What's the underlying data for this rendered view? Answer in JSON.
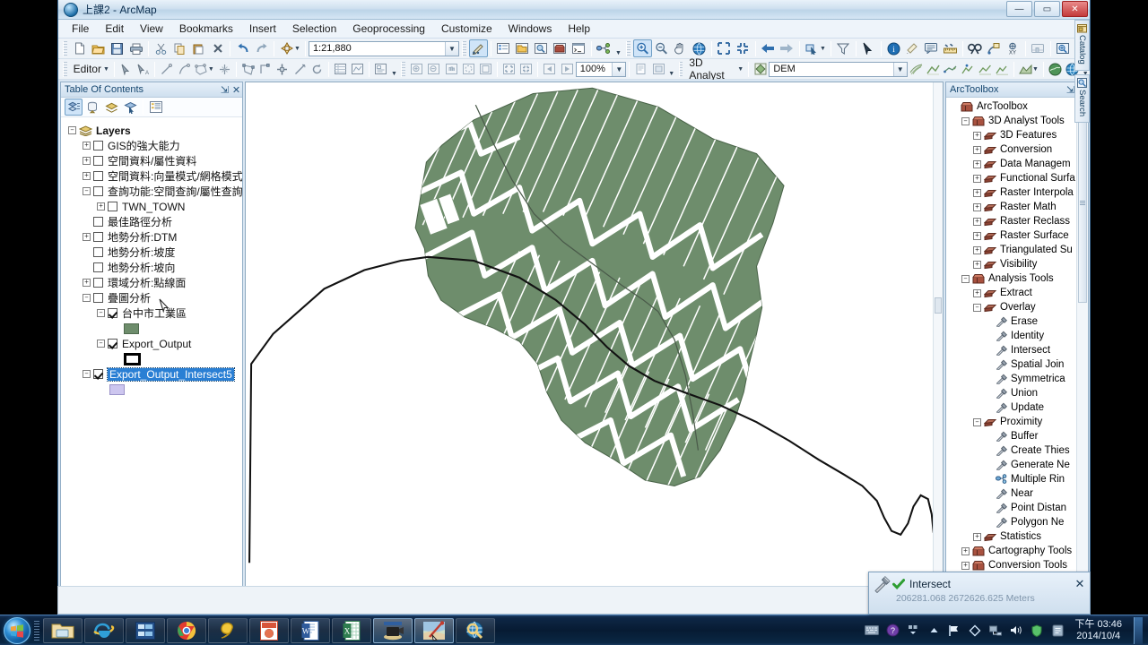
{
  "window": {
    "title": "上課2 - ArcMap",
    "minimize": "—",
    "maximize": "▭",
    "close": "✕"
  },
  "menubar": {
    "items": [
      "File",
      "Edit",
      "View",
      "Bookmarks",
      "Insert",
      "Selection",
      "Geoprocessing",
      "Customize",
      "Windows",
      "Help"
    ]
  },
  "standard_toolbar": {
    "scale_value": "1:21,880",
    "icons": [
      "new-document-icon",
      "open-folder-icon",
      "save-icon",
      "print-icon",
      "cut-icon",
      "copy-icon",
      "paste-icon",
      "delete-icon",
      "undo-icon",
      "redo-icon",
      "add-data-icon"
    ]
  },
  "tools_toolbar": {
    "zoom_percent": "100%",
    "icons": [
      "editor-toolbar-icon",
      "map-scale-icon",
      "zoom-in-icon",
      "zoom-out-icon",
      "pan-icon",
      "full-extent-icon",
      "fixed-zoom-in-icon",
      "fixed-zoom-out-icon",
      "back-extent-icon",
      "forward-extent-icon",
      "select-features-icon",
      "clear-selection-icon",
      "select-elements-icon",
      "identify-icon",
      "hyperlink-icon",
      "html-popup-icon",
      "measure-icon",
      "find-icon",
      "find-route-icon",
      "go-to-xy-icon",
      "time-slider-icon",
      "create-viewer-window-icon"
    ]
  },
  "editor_toolbar": {
    "editor_label": "Editor",
    "icons": [
      "edit-tool-icon",
      "edit-annotation-icon",
      "straight-segment-icon",
      "curve-segment-icon",
      "construct-polygon-icon",
      "midpoint-icon",
      "edit-vertices-icon",
      "reshape-icon",
      "split-icon",
      "trace-icon",
      "rotate-icon",
      "attributes-icon",
      "sketch-properties-icon",
      "create-features-icon"
    ]
  },
  "analyst_toolbar": {
    "analyst_label": "3D Analyst",
    "layer_value": "DEM",
    "icons": [
      "interpolate-line-icon",
      "steepest-path-icon",
      "line-of-sight-icon",
      "profile-graph-icon",
      "arcscene-icon",
      "arcglobe-icon"
    ]
  },
  "toc": {
    "title": "Table Of Contents",
    "pin": "⇲",
    "close": "✕",
    "toolbar_icons": [
      "list-by-drawing-order-icon",
      "list-by-source-icon",
      "list-by-visibility-icon",
      "list-by-selection-icon",
      "options-icon"
    ],
    "root": "Layers",
    "layers": [
      {
        "indent": 1,
        "expander": "+",
        "checked": false,
        "label": "GIS的強大能力"
      },
      {
        "indent": 1,
        "expander": "+",
        "checked": false,
        "label": "空間資料/屬性資料"
      },
      {
        "indent": 1,
        "expander": "+",
        "checked": false,
        "label": "空間資料:向量模式/網格模式"
      },
      {
        "indent": 1,
        "expander": "-",
        "checked": false,
        "label": "查詢功能:空間查詢/屬性查詢"
      },
      {
        "indent": 2,
        "expander": "+",
        "checked": false,
        "label": "TWN_TOWN"
      },
      {
        "indent": 1,
        "expander": "",
        "checked": false,
        "label": "最佳路徑分析"
      },
      {
        "indent": 1,
        "expander": "+",
        "checked": false,
        "label": "地勢分析:DTM"
      },
      {
        "indent": 1,
        "expander": "",
        "checked": false,
        "label": "地勢分析:坡度"
      },
      {
        "indent": 1,
        "expander": "",
        "checked": false,
        "label": "地勢分析:坡向"
      },
      {
        "indent": 1,
        "expander": "+",
        "checked": false,
        "label": "環域分析:點線面"
      },
      {
        "indent": 1,
        "expander": "-",
        "checked": false,
        "label": "疊圖分析"
      },
      {
        "indent": 2,
        "expander": "-",
        "checked": true,
        "label": "台中市工業區",
        "swatch": "green"
      },
      {
        "indent": 2,
        "expander": "-",
        "checked": true,
        "label": "Export_Output",
        "swatch": "hollow"
      },
      {
        "indent": 1,
        "expander": "-",
        "checked": true,
        "label": "Export_Output_Intersect5",
        "selected": true,
        "swatch": "lilac"
      }
    ]
  },
  "toolbox": {
    "title": "ArcToolbox",
    "pin": "⇲",
    "close": "✕",
    "tree": [
      {
        "indent": 0,
        "expander": "",
        "icon": "toolbox-icon",
        "label": "ArcToolbox"
      },
      {
        "indent": 1,
        "expander": "-",
        "icon": "toolbox-icon",
        "label": "3D Analyst Tools"
      },
      {
        "indent": 2,
        "expander": "+",
        "icon": "toolset-icon",
        "label": "3D Features"
      },
      {
        "indent": 2,
        "expander": "+",
        "icon": "toolset-icon",
        "label": "Conversion"
      },
      {
        "indent": 2,
        "expander": "+",
        "icon": "toolset-icon",
        "label": "Data Managem"
      },
      {
        "indent": 2,
        "expander": "+",
        "icon": "toolset-icon",
        "label": "Functional Surfa"
      },
      {
        "indent": 2,
        "expander": "+",
        "icon": "toolset-icon",
        "label": "Raster Interpola"
      },
      {
        "indent": 2,
        "expander": "+",
        "icon": "toolset-icon",
        "label": "Raster Math"
      },
      {
        "indent": 2,
        "expander": "+",
        "icon": "toolset-icon",
        "label": "Raster Reclass"
      },
      {
        "indent": 2,
        "expander": "+",
        "icon": "toolset-icon",
        "label": "Raster Surface"
      },
      {
        "indent": 2,
        "expander": "+",
        "icon": "toolset-icon",
        "label": "Triangulated Su"
      },
      {
        "indent": 2,
        "expander": "+",
        "icon": "toolset-icon",
        "label": "Visibility"
      },
      {
        "indent": 1,
        "expander": "-",
        "icon": "toolbox-icon",
        "label": "Analysis Tools"
      },
      {
        "indent": 2,
        "expander": "+",
        "icon": "toolset-icon",
        "label": "Extract"
      },
      {
        "indent": 2,
        "expander": "-",
        "icon": "toolset-icon",
        "label": "Overlay"
      },
      {
        "indent": 3,
        "expander": "",
        "icon": "tool-icon",
        "label": "Erase"
      },
      {
        "indent": 3,
        "expander": "",
        "icon": "tool-icon",
        "label": "Identity"
      },
      {
        "indent": 3,
        "expander": "",
        "icon": "tool-icon",
        "label": "Intersect"
      },
      {
        "indent": 3,
        "expander": "",
        "icon": "tool-icon",
        "label": "Spatial Join"
      },
      {
        "indent": 3,
        "expander": "",
        "icon": "tool-icon",
        "label": "Symmetrica"
      },
      {
        "indent": 3,
        "expander": "",
        "icon": "tool-icon",
        "label": "Union"
      },
      {
        "indent": 3,
        "expander": "",
        "icon": "tool-icon",
        "label": "Update"
      },
      {
        "indent": 2,
        "expander": "-",
        "icon": "toolset-icon",
        "label": "Proximity"
      },
      {
        "indent": 3,
        "expander": "",
        "icon": "tool-icon",
        "label": "Buffer"
      },
      {
        "indent": 3,
        "expander": "",
        "icon": "tool-icon",
        "label": "Create Thies"
      },
      {
        "indent": 3,
        "expander": "",
        "icon": "tool-icon",
        "label": "Generate Ne"
      },
      {
        "indent": 3,
        "expander": "",
        "icon": "model-tool-icon",
        "label": "Multiple Rin"
      },
      {
        "indent": 3,
        "expander": "",
        "icon": "tool-icon",
        "label": "Near"
      },
      {
        "indent": 3,
        "expander": "",
        "icon": "tool-icon",
        "label": "Point Distan"
      },
      {
        "indent": 3,
        "expander": "",
        "icon": "tool-icon",
        "label": "Polygon Ne"
      },
      {
        "indent": 2,
        "expander": "+",
        "icon": "toolset-icon",
        "label": "Statistics"
      },
      {
        "indent": 1,
        "expander": "+",
        "icon": "toolbox-icon",
        "label": "Cartography Tools"
      },
      {
        "indent": 1,
        "expander": "+",
        "icon": "toolbox-icon",
        "label": "Conversion Tools"
      }
    ]
  },
  "sidetabs": [
    {
      "label": "Catalog",
      "icon": "catalog-icon"
    },
    {
      "label": "Search",
      "icon": "search-icon"
    }
  ],
  "geoprocessing_popup": {
    "tool_name": "Intersect",
    "status_icon": "green-check-icon",
    "tool_icon": "hammer-tool-icon",
    "close": "✕"
  },
  "status_bar": {
    "coordinates": "206281.068  2672626.625 Meters"
  },
  "map_view": {
    "polygon_fill": "#6e8d6c",
    "polygon_outline": "#4a6449",
    "line_color": "#ffffff",
    "road_color": "#000000",
    "background": "#ffffff"
  },
  "taskbar": {
    "start_label": "Start",
    "items": [
      {
        "name": "windows-explorer",
        "icon": "folder-icon",
        "active": false
      },
      {
        "name": "internet-explorer",
        "icon": "ie-icon",
        "active": false
      },
      {
        "name": "media-library",
        "icon": "library-icon",
        "active": false
      },
      {
        "name": "google-chrome",
        "icon": "chrome-icon",
        "active": false
      },
      {
        "name": "reader",
        "icon": "foxit-icon",
        "active": false
      },
      {
        "name": "powerpoint",
        "icon": "powerpoint-icon",
        "active": false
      },
      {
        "name": "word",
        "icon": "word-icon",
        "active": false
      },
      {
        "name": "excel",
        "icon": "excel-icon",
        "active": false
      },
      {
        "name": "screen-recorder",
        "icon": "recorder-icon",
        "active": true
      },
      {
        "name": "arcmap",
        "icon": "arcmap-icon",
        "active": true
      },
      {
        "name": "arccatalog",
        "icon": "arccatalog-icon",
        "active": false
      }
    ],
    "tray_icons": [
      "keyboard-icon",
      "help-icon",
      "hidden-icons-icon",
      "show-hidden-icon",
      "flag-icon",
      "diamond-icon",
      "network-icon",
      "volume-icon",
      "antivirus-icon",
      "action-center-icon"
    ],
    "time": "下午 03:46",
    "date": "2014/10/4"
  }
}
